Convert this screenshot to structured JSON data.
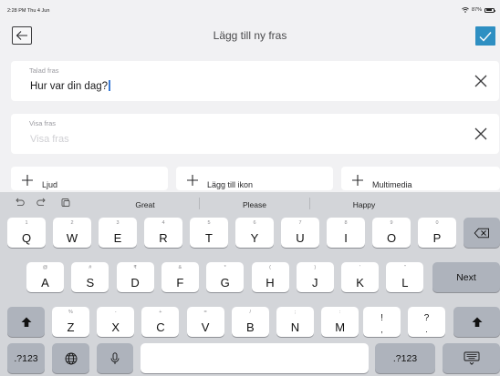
{
  "status_bar": {
    "time": "2:28 PM  Thu 4 Jun",
    "battery": "87%"
  },
  "header": {
    "title": "Lägg till ny fras"
  },
  "spoken_phrase": {
    "label": "Talad fras",
    "value": "Hur var din dag?"
  },
  "display_phrase": {
    "label": "Visa fras",
    "placeholder": "Visa fras"
  },
  "actions": [
    {
      "label": "Ljud"
    },
    {
      "label": "Lägg till ikon"
    },
    {
      "label": "Multimedia"
    }
  ],
  "keyboard": {
    "suggestions": [
      "Great",
      "Please",
      "Happy"
    ],
    "row1": [
      {
        "hint": "1",
        "key": "Q"
      },
      {
        "hint": "2",
        "key": "W"
      },
      {
        "hint": "3",
        "key": "E"
      },
      {
        "hint": "4",
        "key": "R"
      },
      {
        "hint": "5",
        "key": "T"
      },
      {
        "hint": "6",
        "key": "Y"
      },
      {
        "hint": "7",
        "key": "U"
      },
      {
        "hint": "8",
        "key": "I"
      },
      {
        "hint": "9",
        "key": "O"
      },
      {
        "hint": "0",
        "key": "P"
      }
    ],
    "row2": [
      {
        "hint": "@",
        "key": "A"
      },
      {
        "hint": "#",
        "key": "S"
      },
      {
        "hint": "₹",
        "key": "D"
      },
      {
        "hint": "&",
        "key": "F"
      },
      {
        "hint": "*",
        "key": "G"
      },
      {
        "hint": "(",
        "key": "H"
      },
      {
        "hint": ")",
        "key": "J"
      },
      {
        "hint": "'",
        "key": "K"
      },
      {
        "hint": "\"",
        "key": "L"
      }
    ],
    "row3": [
      {
        "hint": "%",
        "key": "Z"
      },
      {
        "hint": "-",
        "key": "X"
      },
      {
        "hint": "+",
        "key": "C"
      },
      {
        "hint": "=",
        "key": "V"
      },
      {
        "hint": "/",
        "key": "B"
      },
      {
        "hint": ";",
        "key": "N"
      },
      {
        "hint": ":",
        "key": "M"
      }
    ],
    "punct": [
      {
        "top": "!",
        "bottom": ","
      },
      {
        "top": "?",
        "bottom": "."
      }
    ],
    "next_label": "Next",
    "numbers_label": ".?123"
  },
  "icons": {
    "back": "arrow-left-icon",
    "confirm": "checkmark-icon",
    "clear": "close-icon",
    "add": "plus-icon",
    "undo": "undo-icon",
    "redo": "redo-icon",
    "paste": "paste-icon",
    "delete": "backspace-icon",
    "shift": "shift-icon",
    "globe": "globe-icon",
    "mic": "microphone-icon",
    "hide": "keyboard-dismiss-icon"
  },
  "colors": {
    "accent": "#2e8fc2",
    "background": "#f1f1f3",
    "keyboard": "#d3d5d9",
    "key_dark": "#aeb3bc"
  }
}
